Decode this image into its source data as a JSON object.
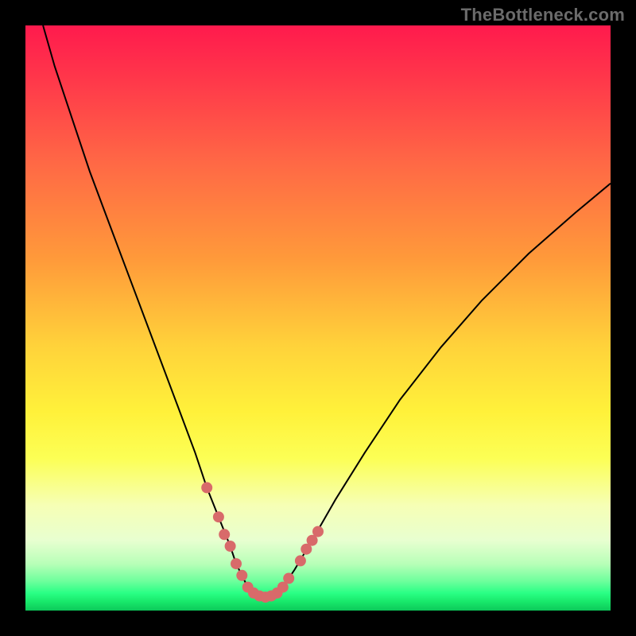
{
  "watermark": {
    "text": "TheBottleneck.com"
  },
  "colors": {
    "background": "#000000",
    "curve": "#000000",
    "marker": "#d86a6a",
    "marker_stroke": "#c95a5a"
  },
  "chart_data": {
    "type": "line",
    "title": "",
    "xlabel": "",
    "ylabel": "",
    "xlim": [
      0,
      100
    ],
    "ylim": [
      0,
      100
    ],
    "grid": false,
    "legend": false,
    "series": [
      {
        "name": "bottleneck-curve",
        "x": [
          3,
          5,
          8,
          11,
          14,
          17,
          20,
          23,
          26,
          29,
          31,
          33,
          35,
          36,
          37,
          38,
          39,
          40,
          41,
          42,
          43,
          44,
          46,
          49,
          53,
          58,
          64,
          71,
          78,
          86,
          94,
          100
        ],
        "values": [
          100,
          93,
          84,
          75,
          67,
          59,
          51,
          43,
          35,
          27,
          21,
          16,
          11,
          8,
          6,
          4,
          3,
          2.5,
          2.3,
          2.5,
          3,
          4,
          7,
          12,
          19,
          27,
          36,
          45,
          53,
          61,
          68,
          73
        ]
      }
    ],
    "markers": [
      {
        "x": 31,
        "y": 21
      },
      {
        "x": 33,
        "y": 16
      },
      {
        "x": 34,
        "y": 13
      },
      {
        "x": 35,
        "y": 11
      },
      {
        "x": 36,
        "y": 8
      },
      {
        "x": 37,
        "y": 6
      },
      {
        "x": 38,
        "y": 4
      },
      {
        "x": 39,
        "y": 3
      },
      {
        "x": 40,
        "y": 2.5
      },
      {
        "x": 41,
        "y": 2.3
      },
      {
        "x": 42,
        "y": 2.5
      },
      {
        "x": 43,
        "y": 3
      },
      {
        "x": 44,
        "y": 4
      },
      {
        "x": 45,
        "y": 5.5
      },
      {
        "x": 47,
        "y": 8.5
      },
      {
        "x": 48,
        "y": 10.5
      },
      {
        "x": 49,
        "y": 12
      },
      {
        "x": 50,
        "y": 13.5
      }
    ]
  }
}
